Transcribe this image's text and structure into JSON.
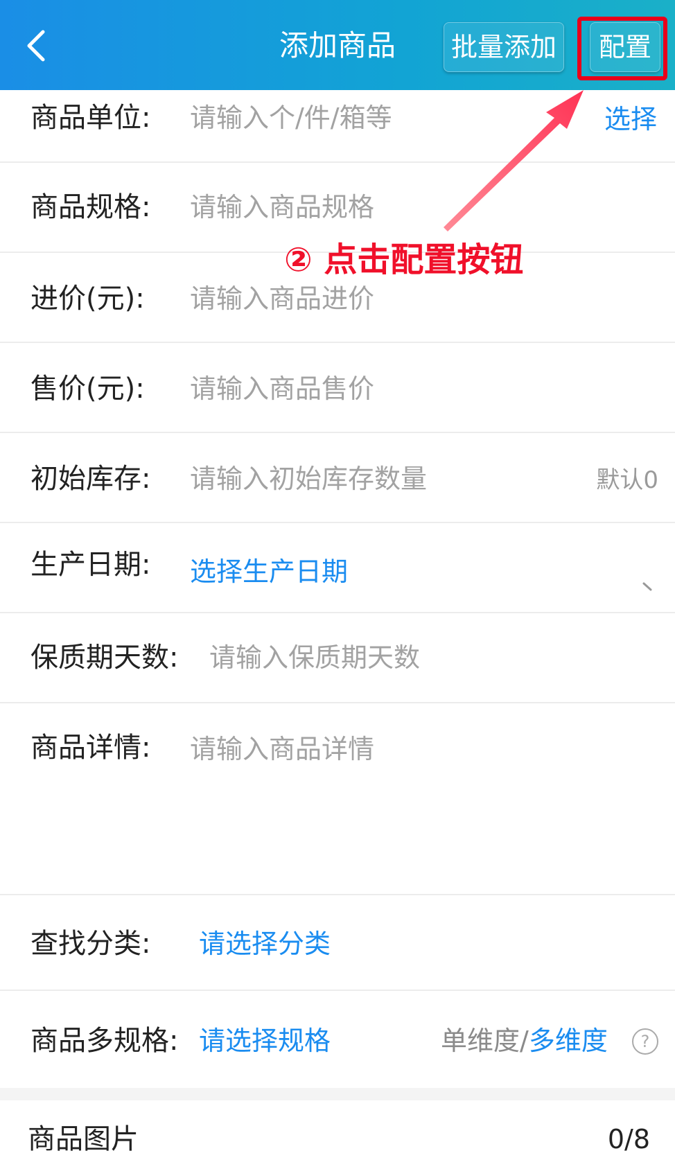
{
  "header": {
    "back_icon": "chevron-left-icon",
    "title": "添加商品",
    "batch_add_label": "批量添加",
    "config_label": "配置"
  },
  "annotation": {
    "text": "② 点击配置按钮",
    "color": "#f0102a"
  },
  "form": {
    "unit": {
      "label": "商品单位:",
      "placeholder": "请输入个/件/箱等",
      "action": "选择"
    },
    "spec": {
      "label": "商品规格:",
      "placeholder": "请输入商品规格"
    },
    "cost": {
      "label": "进价(元):",
      "placeholder": "请输入商品进价"
    },
    "price": {
      "label": "售价(元):",
      "placeholder": "请输入商品售价"
    },
    "stock": {
      "label": "初始库存:",
      "placeholder": "请输入初始库存数量",
      "hint": "默认0"
    },
    "mfg_date": {
      "label": "生产日期:",
      "value": "选择生产日期"
    },
    "shelf_life": {
      "label": "保质期天数:",
      "placeholder": "请输入保质期天数"
    },
    "details": {
      "label": "商品详情:",
      "placeholder": "请输入商品详情"
    },
    "category": {
      "label": "查找分类:",
      "value": "请选择分类"
    },
    "multi_spec": {
      "label": "商品多规格:",
      "value": "请选择规格",
      "mode_single": "单维度/",
      "mode_multi": "多维度",
      "help_icon": "question-circle-icon"
    },
    "images": {
      "label": "商品图片",
      "count": "0/8"
    }
  },
  "colors": {
    "accent": "#1a8cf0",
    "header_start": "#1a8ee6",
    "header_end": "#1ab0c8",
    "highlight": "#e8001a"
  }
}
